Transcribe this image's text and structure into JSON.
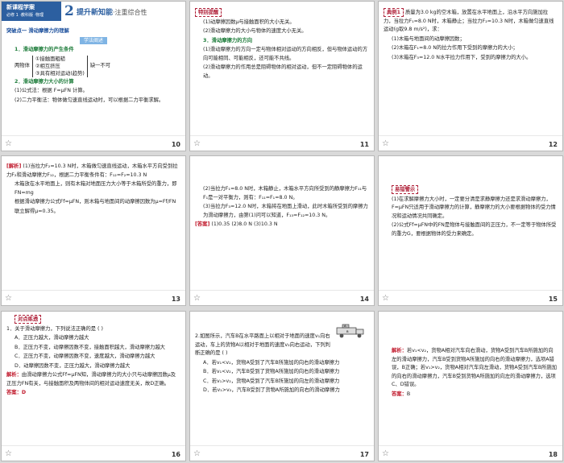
{
  "slides": [
    {
      "page": "10",
      "header": {
        "badge_top": "新课程学案",
        "badge_bottom": "必修 1 ·教科版 ·物理",
        "num": "2",
        "title": "提升新知能",
        "subtitle": "·注重综合性"
      },
      "section": "突破点一  滑动摩擦力的理解",
      "boxhead": "学法阐述",
      "l1": "1．滑动摩擦力的产生条件",
      "prefix": "两物体",
      "cond": [
        "①接触面粗糙",
        "②相互挤压",
        "③具有相对运动(趋势)"
      ],
      "suffix": "缺一不可",
      "l2": "2．滑动摩擦力大小的计算",
      "l3": "(1)公式法：根据 F=μFN 计算。",
      "l4": "(2)二力平衡法：物体做匀速直线运动时，可以根据二力平衡求解。"
    },
    {
      "page": "11",
      "tag": "特别提醒",
      "l1": "(1)动摩擦因数μ与接触面积的大小无关。",
      "l2": "(2)滑动摩擦力的大小与物体的速度大小无关。",
      "l3": "3．滑动摩擦力的方向",
      "l4": "(1)滑动摩擦力的方向一定与物体相对运动的方向相反，但与物体运动的方向可能相同、可能相反，还可能不共线。",
      "l5": "(2)滑动摩擦力的作用总是阻碍物体的相对运动，但不一定阻碍物体的运动。"
    },
    {
      "page": "12",
      "tag": "典例1",
      "l1": "质量为3.0 kg的空木箱，放置在水平地面上，沿水平方向施加拉力，当拉力F₁=8.0 N时，木箱静止；当拉力F₂=10.3 N时，木箱做匀速直线运动(g取9.8 m/s²)，求：",
      "l2": "(1)木箱与地面间的动摩擦因数；",
      "l3": "(2)木箱在F₁=8.0 N的拉力作用下受到的摩擦力的大小；",
      "l4": "(3)木箱在F₃=12.0 N水平拉力作用下，受到的摩擦力的大小。"
    },
    {
      "page": "13",
      "label": "[解析]",
      "l1": "(1)当拉力F₂=10.3 N时，木箱做匀速直线运动，木箱水平方向受到拉力F₂和滑动摩擦力F₁₂，根据二力平衡条件有：F₁₂=F₂=10.3 N",
      "l2": "木箱放在水平地面上，则有木箱对地面压力大小等于木箱所受的重力，即FN=mg",
      "l3": "根据滑动摩擦力公式Ff=μFN，则木箱与地面间的动摩擦因数为μ=Ff/FN",
      "l4": "联立解得μ=0.35。"
    },
    {
      "page": "14",
      "l1": "(2)当拉力F₁=8.0 N时，木箱静止，木箱水平方向所受到的静摩擦力F₁₁与F₁是一对平衡力，则有：F₁₁=F₁=8.0 N。",
      "l2": "(3)当拉力F₃=12.0 N时，木箱将在地面上滑动，此时木箱所受到的摩擦力为滑动摩擦力，由第(1)问可以知道，F₁₃=F₁₂=10.3 N。",
      "answer_label": "[答案]",
      "answer": "(1)0.35  (2)8.0 N  (3)10.3 N"
    },
    {
      "page": "15",
      "tag": "易错警示",
      "l1": "(1)在求解摩擦力大小时，一定要分清是求静摩擦力还是求滑动摩擦力，F=μFN只适用于滑动摩擦力的计算，静摩擦力的大小要根据物体的受力情况和运动情况共同确定。",
      "l2": "(2)公式Ff=μFN中的FN是物体与接触面间的正压力，不一定等于物体所受的重力G，要根据物体的受力来确定。"
    },
    {
      "page": "16",
      "tag": "对点练透",
      "q": "1．关于滑动摩擦力，下列说法正确的是        (   )",
      "a": "A．正压力越大，滑动摩擦力越大",
      "b": "B．正压力不变，动摩擦因数不变，接触面积越大，滑动摩擦力越大",
      "c": "C．正压力不变，动摩擦因数不变，速度越大，滑动摩擦力越大",
      "d": "D．动摩擦因数不变，正压力越大，滑动摩擦力越大",
      "ex_label": "解析：",
      "ex": "由滑动摩擦力公式Ff=μFN知，滑动摩擦力的大小只与动摩擦因数μ及正压力FN有关，与接触面积及两物体间的相对运动速度无关，故D正确。",
      "ans_label": "答案：",
      "ans": "D"
    },
    {
      "page": "17",
      "q": "2.如图所示，汽车B在水平路面上以相对于地面的速度v₁向右运动，车上的货物A以相对于地面的速度v₂向右运动，下列判断正确的是       (   )",
      "a": "A．若v₁<v₂，货物A受到了汽车B所施加的向右的滑动摩擦力",
      "b": "B．若v₁<v₂，汽车B受到了货物A所施加的向右的滑动摩擦力",
      "c": "C．若v₁>v₂，货物A受到了汽车B所施加的向左的滑动摩擦力",
      "d": "D．若v₁>v₂，汽车B受到了货物A所施加的向右的滑动摩擦力",
      "fig_a": "A",
      "fig_b": "B"
    },
    {
      "page": "18",
      "ex_label": "解析：",
      "ex1": "若v₁<v₂，货物A相对汽车向右滑动，货物A受到汽车B所施加的向左的滑动摩擦力，汽车B受到货物A所施加的向右的滑动摩擦力，选项A错误，B正确；若v₁>v₂，货物A相对汽车向左滑动，货物A受到汽车B所施加的向右的滑动摩擦力，汽车B受到货物A所施加的向左的滑动摩擦力，选项C、D错误。",
      "ans_label": "答案：",
      "ans": "B"
    }
  ]
}
